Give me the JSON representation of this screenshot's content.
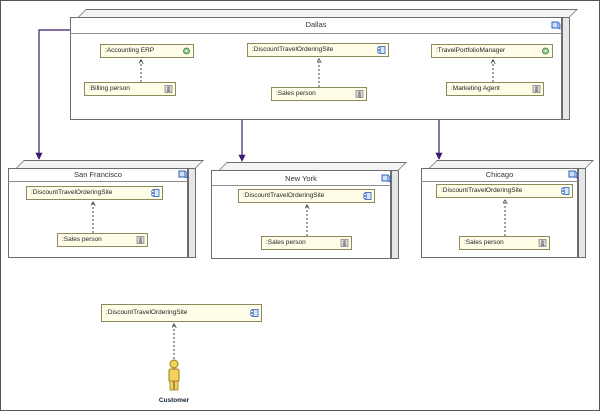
{
  "colors": {
    "link": "#3a1d6e",
    "dependency": "#333333",
    "component_fill": "#fffde8",
    "component_border": "#8c8a5a"
  },
  "nodes": {
    "dallas": {
      "title": "Dallas",
      "icon": "node-cube-icon",
      "accounting": ":Accounting ERP",
      "discount_site": ":DiscountTravelOrderingSite",
      "portfolio": ":TravelPortfolioManager",
      "billing": ":Billing person",
      "sales": ":Sales person",
      "marketing": ":Marketing Agent"
    },
    "san_francisco": {
      "title": "San Francisco",
      "icon": "node-cube-icon",
      "discount_site": ":DiscountTravelOrderingSite",
      "sales": ":Sales person"
    },
    "new_york": {
      "title": "New York",
      "icon": "node-cube-icon",
      "discount_site": ":DiscountTravelOrderingSite",
      "sales": ":Sales person"
    },
    "chicago": {
      "title": "Chicago",
      "icon": "node-cube-icon",
      "discount_site": ":DiscountTravelOrderingSite",
      "sales": ":Sales person"
    }
  },
  "standalone": {
    "discount_site": ":DiscountTravelOrderingSite",
    "customer": "Customer"
  }
}
